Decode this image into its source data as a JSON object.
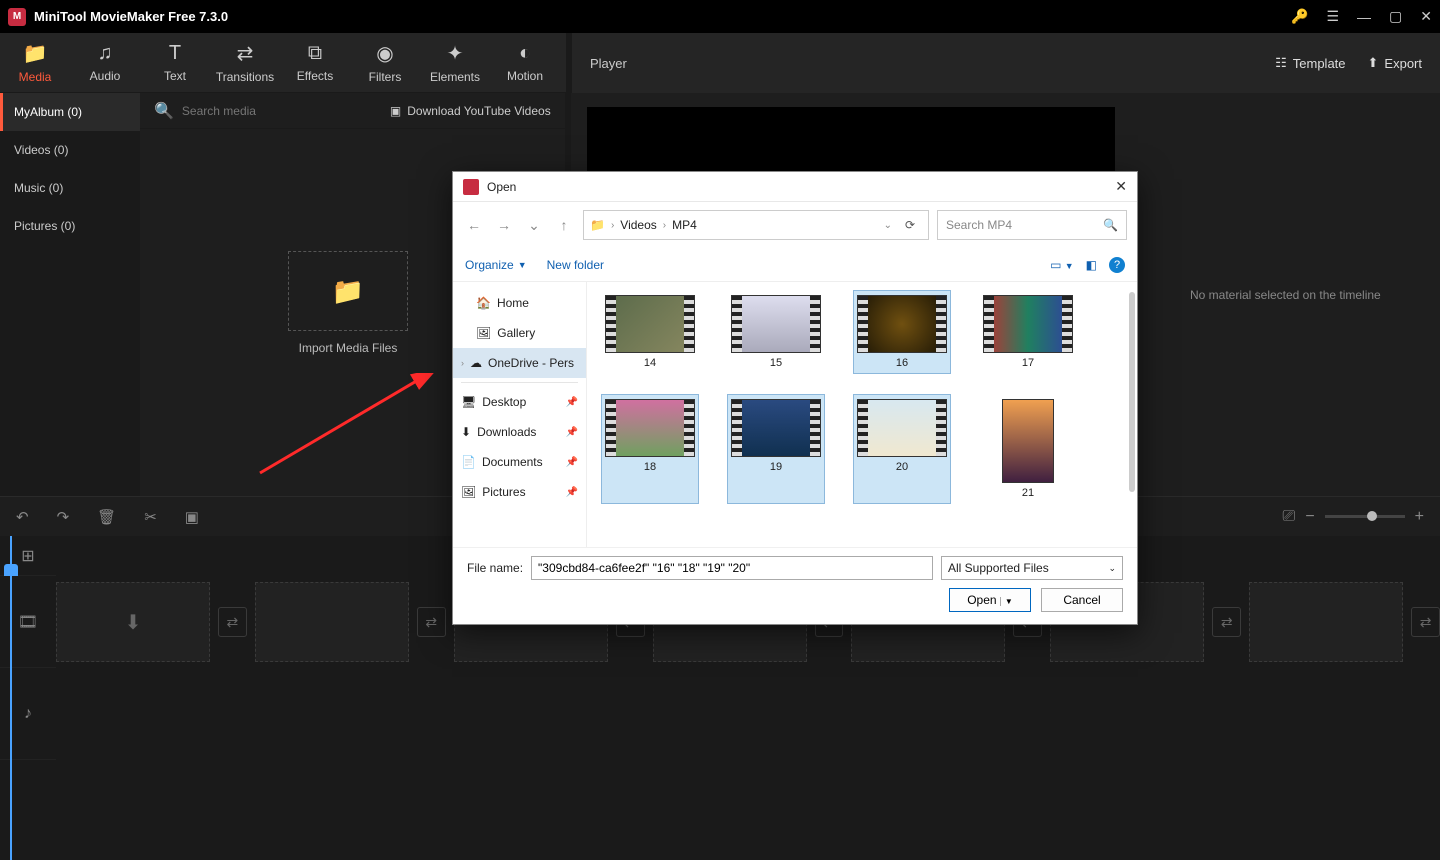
{
  "titlebar": {
    "title": "MiniTool MovieMaker Free 7.3.0"
  },
  "ribbon": [
    {
      "label": "Media",
      "icon": "📁",
      "active": true
    },
    {
      "label": "Audio",
      "icon": "♫"
    },
    {
      "label": "Text",
      "icon": "T"
    },
    {
      "label": "Transitions",
      "icon": "⇄"
    },
    {
      "label": "Effects",
      "icon": "⧉"
    },
    {
      "label": "Filters",
      "icon": "◉"
    },
    {
      "label": "Elements",
      "icon": "✦"
    },
    {
      "label": "Motion",
      "icon": "◐"
    }
  ],
  "sidebar": [
    {
      "label": "MyAlbum (0)",
      "active": true
    },
    {
      "label": "Videos (0)"
    },
    {
      "label": "Music (0)"
    },
    {
      "label": "Pictures (0)"
    }
  ],
  "media": {
    "search_placeholder": "Search media",
    "download_label": "Download YouTube Videos",
    "dropzone_label": "Import Media Files"
  },
  "player": {
    "title": "Player",
    "template_label": "Template",
    "export_label": "Export",
    "no_material": "No material selected on the timeline"
  },
  "dialog": {
    "title": "Open",
    "breadcrumb": [
      "Videos",
      "MP4"
    ],
    "search_placeholder": "Search MP4",
    "organize": "Organize",
    "new_folder": "New folder",
    "side": [
      {
        "label": "Home",
        "icon": "🏠"
      },
      {
        "label": "Gallery",
        "icon": "🖼"
      },
      {
        "label": "OneDrive - Pers",
        "icon": "☁",
        "sel": true,
        "expand": true
      }
    ],
    "side2": [
      {
        "label": "Desktop",
        "icon": "🖥",
        "pin": true
      },
      {
        "label": "Downloads",
        "icon": "⬇",
        "pin": true
      },
      {
        "label": "Documents",
        "icon": "📄",
        "pin": true
      },
      {
        "label": "Pictures",
        "icon": "🖼",
        "pin": true
      }
    ],
    "files": [
      {
        "name": "14",
        "cls": "th14"
      },
      {
        "name": "15",
        "cls": "th15"
      },
      {
        "name": "16",
        "cls": "th16",
        "sel": true
      },
      {
        "name": "17",
        "cls": "th17"
      },
      {
        "name": "18",
        "cls": "th18",
        "sel": true
      },
      {
        "name": "19",
        "cls": "th19",
        "sel": true
      },
      {
        "name": "20",
        "cls": "th20",
        "sel": true
      },
      {
        "name": "21",
        "cls": "th21",
        "portrait": true
      }
    ],
    "file_name_label": "File name:",
    "file_name_value": "\"309cbd84-ca6fee2f\" \"16\" \"18\" \"19\" \"20\"",
    "file_type": "All Supported Files",
    "open": "Open",
    "cancel": "Cancel"
  }
}
